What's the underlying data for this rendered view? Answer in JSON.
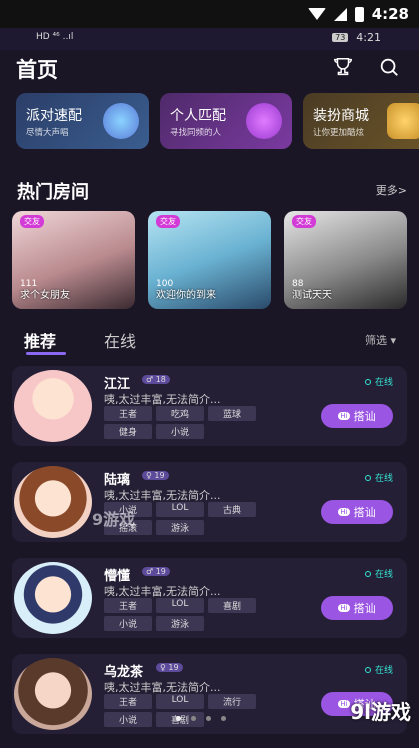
{
  "outer_status": {
    "time": "4:28"
  },
  "inner_status": {
    "left": "HD ⁴⁶ ..ıl",
    "battery": "73",
    "time": "4:21"
  },
  "header": {
    "title": "首页"
  },
  "quick_cards": [
    {
      "title": "派对速配",
      "subtitle": "尽情大声唱",
      "bg": "#2b3e68"
    },
    {
      "title": "个人匹配",
      "subtitle": "寻找同频的人",
      "bg": "#4f2a6a"
    },
    {
      "title": "装扮商城",
      "subtitle": "让你更加酷炫",
      "bg": "#4a3b24"
    }
  ],
  "rooms_section": {
    "title": "热门房间",
    "more": "更多>"
  },
  "rooms": [
    {
      "badge": "交友",
      "name": "求个女朋友",
      "listeners": "111"
    },
    {
      "badge": "交友",
      "name": "欢迎你的到来",
      "listeners": "100"
    },
    {
      "badge": "交友",
      "name": "测试天天",
      "listeners": "88"
    }
  ],
  "tabs": {
    "recommend": "推荐",
    "online": "在线",
    "filter": "筛选 ▾"
  },
  "users": [
    {
      "name": "江江",
      "age": "♂ 18",
      "desc": "咦,太过丰富,无法简介...",
      "tags": [
        "王者",
        "吃鸡",
        "蓝球",
        "健身",
        "小说"
      ],
      "status": "在线",
      "action": "搭讪"
    },
    {
      "name": "陆璃",
      "age": "♀ 19",
      "desc": "咦,太过丰富,无法简介...",
      "tags": [
        "小说",
        "LOL",
        "古典",
        "摇滚",
        "游泳"
      ],
      "status": "在线",
      "action": "搭讪"
    },
    {
      "name": "懵懂",
      "age": "♂ 19",
      "desc": "咦,太过丰富,无法简介...",
      "tags": [
        "王者",
        "LOL",
        "喜剧",
        "小说",
        "游泳"
      ],
      "status": "在线",
      "action": "搭讪"
    },
    {
      "name": "乌龙茶",
      "age": "♀ 19",
      "desc": "咦,太过丰富,无法简介...",
      "tags": [
        "王者",
        "LOL",
        "流行",
        "小说",
        "喜剧"
      ],
      "status": "在线",
      "action": "搭讪"
    }
  ],
  "watermarks": {
    "center": "9游戏",
    "corner": "9l游戏"
  }
}
